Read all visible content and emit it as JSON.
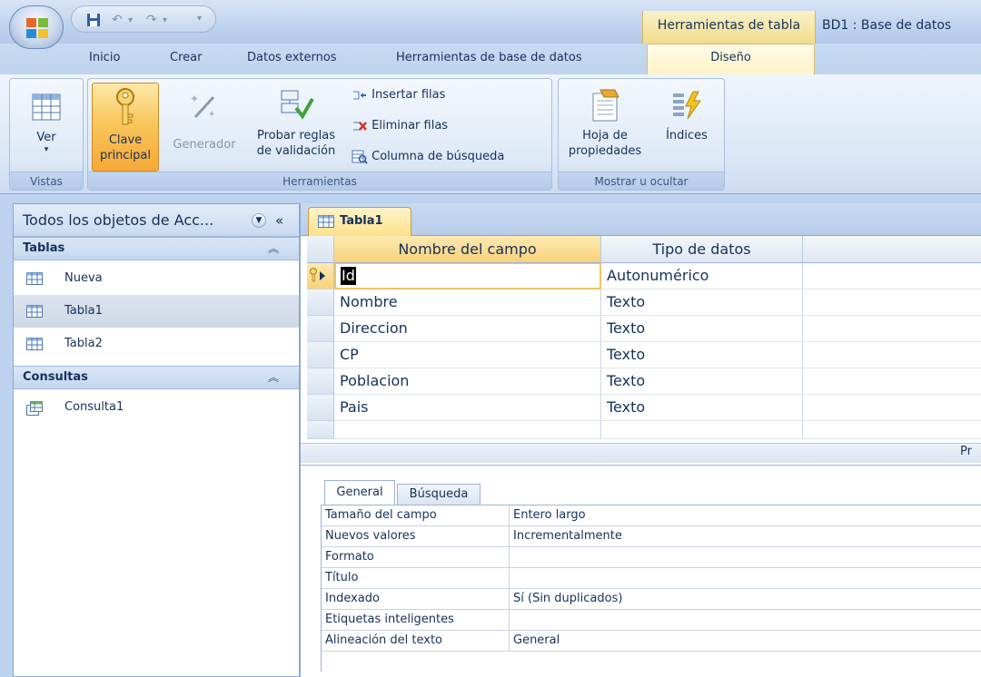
{
  "titlebar": {
    "context_label": "Herramientas de tabla",
    "app_title": "BD1 : Base de datos"
  },
  "tabs": {
    "inicio": "Inicio",
    "crear": "Crear",
    "datos_externos": "Datos externos",
    "herramientas_bd": "Herramientas de base de datos",
    "diseno": "Diseño"
  },
  "ribbon": {
    "vistas": {
      "ver_label": "Ver",
      "group_label": "Vistas"
    },
    "herramientas": {
      "clave_line1": "Clave",
      "clave_line2": "principal",
      "generador": "Generador",
      "probar_line1": "Probar reglas",
      "probar_line2": "de validación",
      "insertar_filas": "Insertar filas",
      "eliminar_filas": "Eliminar filas",
      "columna_busqueda": "Columna de búsqueda",
      "group_label": "Herramientas"
    },
    "mostrar": {
      "hoja_line1": "Hoja de",
      "hoja_line2": "propiedades",
      "indices": "Índices",
      "group_label": "Mostrar u ocultar"
    }
  },
  "nav": {
    "header": "Todos los objetos de Acc...",
    "collapse": "«",
    "sections": [
      {
        "label": "Tablas",
        "items": [
          "Nueva",
          "Tabla1",
          "Tabla2"
        ]
      },
      {
        "label": "Consultas",
        "items": [
          "Consulta1"
        ]
      }
    ],
    "selected_item": "Tabla1"
  },
  "document": {
    "tab_label": "Tabla1",
    "columns": [
      "Nombre del campo",
      "Tipo de datos"
    ],
    "rows": [
      {
        "field": "Id",
        "type": "Autonumérico",
        "primary_key": true
      },
      {
        "field": "Nombre",
        "type": "Texto"
      },
      {
        "field": "Direccion",
        "type": "Texto"
      },
      {
        "field": "CP",
        "type": "Texto"
      },
      {
        "field": "Poblacion",
        "type": "Texto"
      },
      {
        "field": "Pais",
        "type": "Texto"
      }
    ],
    "props_title_fragment": "Pr"
  },
  "properties": {
    "tabs": [
      "General",
      "Búsqueda"
    ],
    "rows": [
      {
        "name": "Tamaño del campo",
        "value": "Entero largo"
      },
      {
        "name": "Nuevos valores",
        "value": "Incrementalmente"
      },
      {
        "name": "Formato",
        "value": ""
      },
      {
        "name": "Título",
        "value": ""
      },
      {
        "name": "Indexado",
        "value": "Sí (Sin duplicados)"
      },
      {
        "name": "Etiquetas inteligentes",
        "value": ""
      },
      {
        "name": "Alineación del texto",
        "value": "General"
      }
    ]
  },
  "colors": {
    "accent_orange": "#f9c65c",
    "ribbon_blue": "#dbe7f7",
    "context_yellow": "#f1dc8b"
  }
}
